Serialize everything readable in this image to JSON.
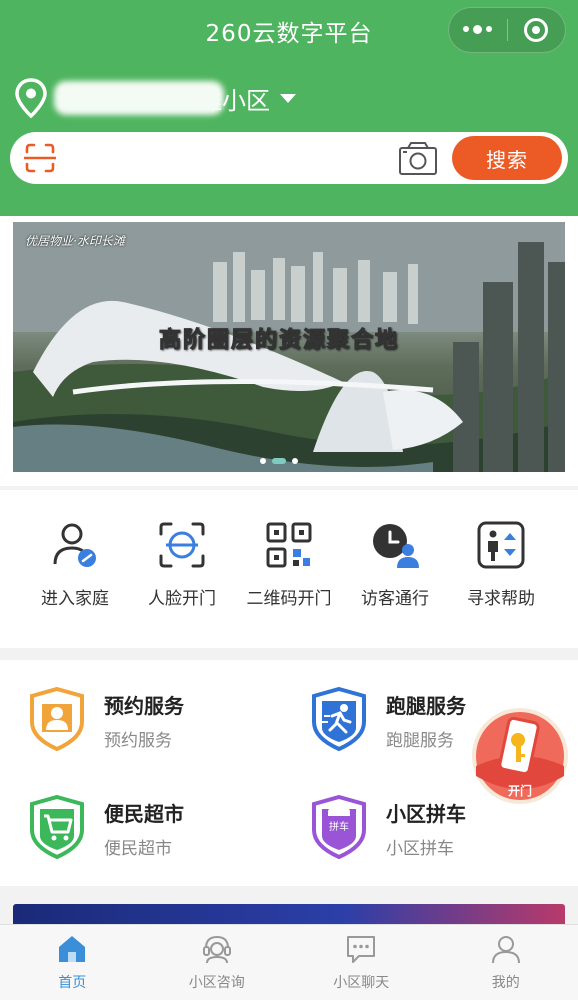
{
  "app": {
    "title": "260云数字平台"
  },
  "location": {
    "name": "滩小区"
  },
  "search": {
    "placeholder": "",
    "button_label": "搜索"
  },
  "banner": {
    "tag": "优居物业·水印长滩",
    "slogan": "高阶圈层的资源聚合地",
    "slide_count": 3,
    "active_slide": 2
  },
  "quick_actions": [
    {
      "label": "进入家庭",
      "icon": "enter-home-icon"
    },
    {
      "label": "人脸开门",
      "icon": "face-unlock-icon"
    },
    {
      "label": "二维码开门",
      "icon": "qrcode-icon"
    },
    {
      "label": "访客通行",
      "icon": "visitor-icon"
    },
    {
      "label": "寻求帮助",
      "icon": "help-icon"
    }
  ],
  "services": [
    {
      "title": "预约服务",
      "subtitle": "预约服务",
      "icon": "appointment-icon",
      "color": "#f0a43a"
    },
    {
      "title": "跑腿服务",
      "subtitle": "跑腿服务",
      "icon": "errand-icon",
      "color": "#2f73d6"
    },
    {
      "title": "便民超市",
      "subtitle": "便民超市",
      "icon": "supermarket-icon",
      "color": "#3cb85a"
    },
    {
      "title": "小区拼车",
      "subtitle": "小区拼车",
      "icon": "carpool-icon",
      "color": "#9a55d6",
      "badge": "拼车"
    }
  ],
  "float_button": {
    "label": "开门"
  },
  "tabbar": [
    {
      "label": "首页",
      "icon": "home-icon",
      "active": true
    },
    {
      "label": "小区咨询",
      "icon": "consult-icon",
      "active": false
    },
    {
      "label": "小区聊天",
      "icon": "chat-icon",
      "active": false
    },
    {
      "label": "我的",
      "icon": "profile-icon",
      "active": false
    }
  ],
  "colors": {
    "header_green": "#4fb45f",
    "search_orange": "#ec5a26",
    "tab_active_blue": "#3a8fd8"
  }
}
